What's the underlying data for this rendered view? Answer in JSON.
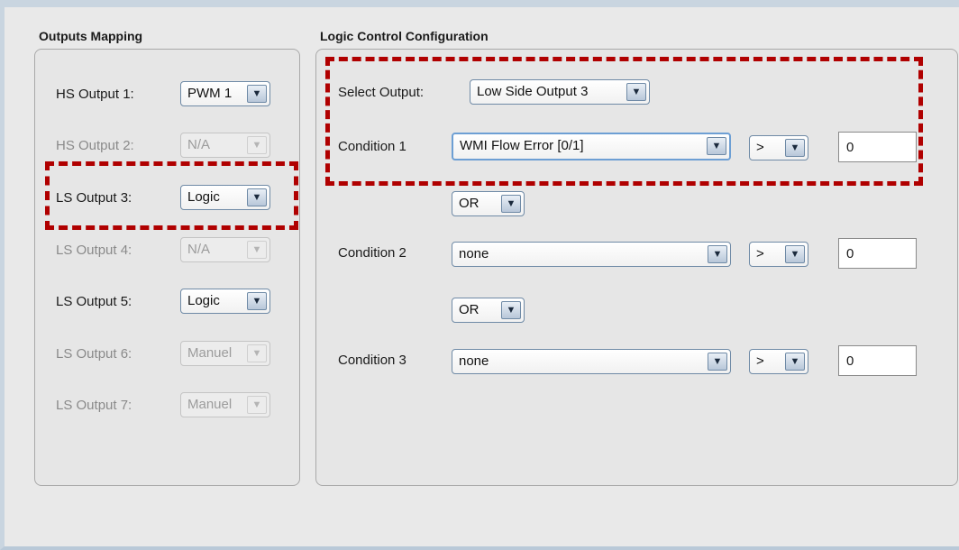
{
  "outputs_mapping": {
    "title": "Outputs Mapping",
    "rows": [
      {
        "label": "HS Output 1:",
        "value": "PWM 1",
        "enabled": true
      },
      {
        "label": "HS Output 2:",
        "value": "N/A",
        "enabled": false
      },
      {
        "label": "LS Output 3:",
        "value": "Logic",
        "enabled": true,
        "highlighted": true
      },
      {
        "label": "LS Output 4:",
        "value": "N/A",
        "enabled": false
      },
      {
        "label": "LS Output 5:",
        "value": "Logic",
        "enabled": true
      },
      {
        "label": "LS Output 6:",
        "value": "Manuel",
        "enabled": false
      },
      {
        "label": "LS Output 7:",
        "value": "Manuel",
        "enabled": false
      }
    ]
  },
  "logic_control": {
    "title": "Logic Control Configuration",
    "select_output": {
      "label": "Select Output:",
      "value": "Low Side Output 3"
    },
    "conditions": [
      {
        "label": "Condition 1",
        "signal": "WMI Flow Error [0/1]",
        "operator": ">",
        "threshold": "0"
      },
      {
        "label": "Condition 2",
        "signal": "none",
        "operator": ">",
        "threshold": "0"
      },
      {
        "label": "Condition 3",
        "signal": "none",
        "operator": ">",
        "threshold": "0"
      }
    ],
    "connectors": [
      "OR",
      "OR"
    ]
  },
  "icons": {
    "dropdown_arrow": "▼"
  },
  "colors": {
    "highlight": "#b00000",
    "frame": "#c9d5e0"
  }
}
